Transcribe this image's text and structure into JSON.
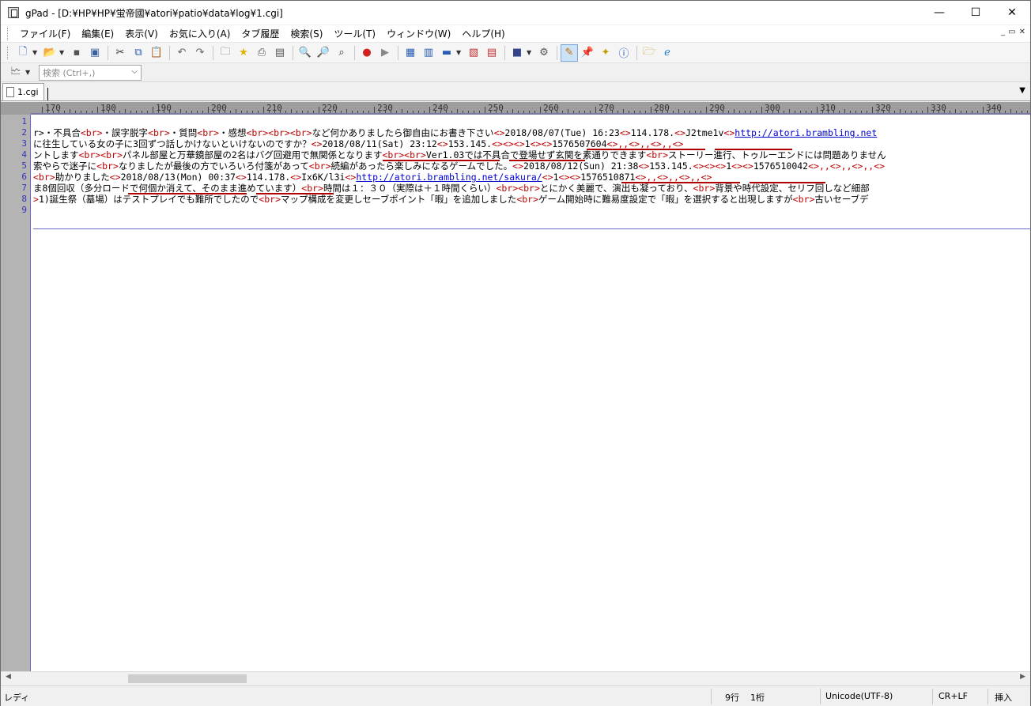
{
  "window": {
    "title": "gPad - [D:¥HP¥HP¥蛍帝國¥atori¥patio¥data¥log¥1.cgi]",
    "minimize": "—",
    "maximize": "☐",
    "close": "✕"
  },
  "menu": {
    "items": [
      "ファイル(F)",
      "編集(E)",
      "表示(V)",
      "お気に入り(A)",
      "タブ履歴",
      "検索(S)",
      "ツール(T)",
      "ウィンドウ(W)",
      "ヘルプ(H)"
    ],
    "mdi": [
      "_",
      "▭",
      "✕"
    ]
  },
  "search": {
    "placeholder": "検索 (Ctrl+,)"
  },
  "tabs": [
    {
      "label": "1.cgi"
    }
  ],
  "ruler": {
    "labels": [
      "170",
      "180",
      "190",
      "200",
      "210",
      "220",
      "230",
      "240",
      "250",
      "260",
      "270",
      "280",
      "290",
      "300",
      "310",
      "320",
      "330",
      "340"
    ]
  },
  "editor": {
    "line_numbers": [
      "1",
      "2",
      "3",
      "4",
      "5",
      "6",
      "7",
      "8",
      "9"
    ],
    "lines": {
      "l2": {
        "a": "r>・不具合",
        "t1": "<br>",
        "b": "・誤字脱字",
        "t2": "<br>",
        "c": "・質問",
        "t3": "<br>",
        "d": "・感想",
        "t4": "<br><br><br>",
        "e": "など何かありましたら御自由にお書き下さい",
        "t5": "<>",
        "date": "2018/08/07(Tue) 16:23",
        "t6": "<>",
        "ip": "114.178.",
        "t7": "<>",
        "id": "J2tme1v",
        "t8": "<>",
        "url": "http://atori.brambling.net"
      },
      "l3": {
        "a": "に往生している女の子に3回ずつ話しかけないといけないのですか？",
        "t1": "<>",
        "date": "2018/08/11(Sat) 23:12",
        "t2": "<>",
        "ip": "153.145.",
        "t3": "<><><>",
        "n1": "1",
        "t4": "<><>",
        "n2": "1576507604",
        "t5": "<>,,<>,,<>,,<>"
      },
      "l4": {
        "a": "ントします",
        "t1": "<br><br>",
        "b": "パネル部屋と万華鏡部屋の2名はバグ回避用で無関係となります",
        "t2": "<br><br>",
        "c": "Ver1.03では不具合で登場せず玄関を素通りできます",
        "t3": "<br>",
        "d": "ストーリー進行、トゥルーエンドには問題ありません"
      },
      "l5": {
        "a": "索やらで迷子に",
        "t1": "<br>",
        "b": "なりましたが最後の方でいろいろ付箋があって",
        "t2": "<br>",
        "c": "続編があったら楽しみになるゲームでした。",
        "t3": "<>",
        "date": "2018/08/12(Sun) 21:38",
        "t4": "<>",
        "ip": "153.145.",
        "t5": "<><><>",
        "n1": "1",
        "t6": "<><>",
        "n2": "1576510042",
        "t7": "<>,,<>,,<>,,<>"
      },
      "l6": {
        "t0": "<br>",
        "a": "助かりました",
        "t1": "<>",
        "date": "2018/08/13(Mon) 00:37",
        "t2": "<>",
        "ip": "114.178.",
        "t3": "<>",
        "id": "Ix6K/l3i",
        "t4": "<>",
        "url": "http://atori.brambling.net/sakura/",
        "t5": "<>",
        "n1": "1",
        "t6": "<><>",
        "n2": "1576510871",
        "t7": "<>,,<>,,<>,,<>"
      },
      "l7": {
        "a": "ま8個回収（多分ロードで何個か消えて、そのまま進めています）",
        "t1": "<br>",
        "b": "時間は１：３０（実際は＋１時間くらい）",
        "t2": "<br><br>",
        "c": "とにかく美麗で、演出も凝っており、",
        "t3": "<br>",
        "d": "背景や時代設定、セリフ回しなど細部"
      },
      "l8": {
        "t0": ">",
        "a": "1)誕生祭（墓場）はテストプレイでも難所でしたので",
        "t1": "<br>",
        "b": "マップ構成を変更しセーブポイント「暇」を追加しました",
        "t2": "<br>",
        "c": "ゲーム開始時に難易度設定で「暇」を選択すると出現しますが",
        "t3": "<br>",
        "d": "古いセーブデ"
      }
    }
  },
  "status": {
    "ready": "レディ",
    "line": "9行",
    "column": "1桁",
    "encoding": "Unicode(UTF-8)",
    "newline": "CR+LF",
    "mode": "挿入"
  },
  "colors": {
    "tag": "#c00000",
    "link": "#0000d0",
    "line_number": "#3333bb",
    "underline_mark": "#b00000"
  }
}
